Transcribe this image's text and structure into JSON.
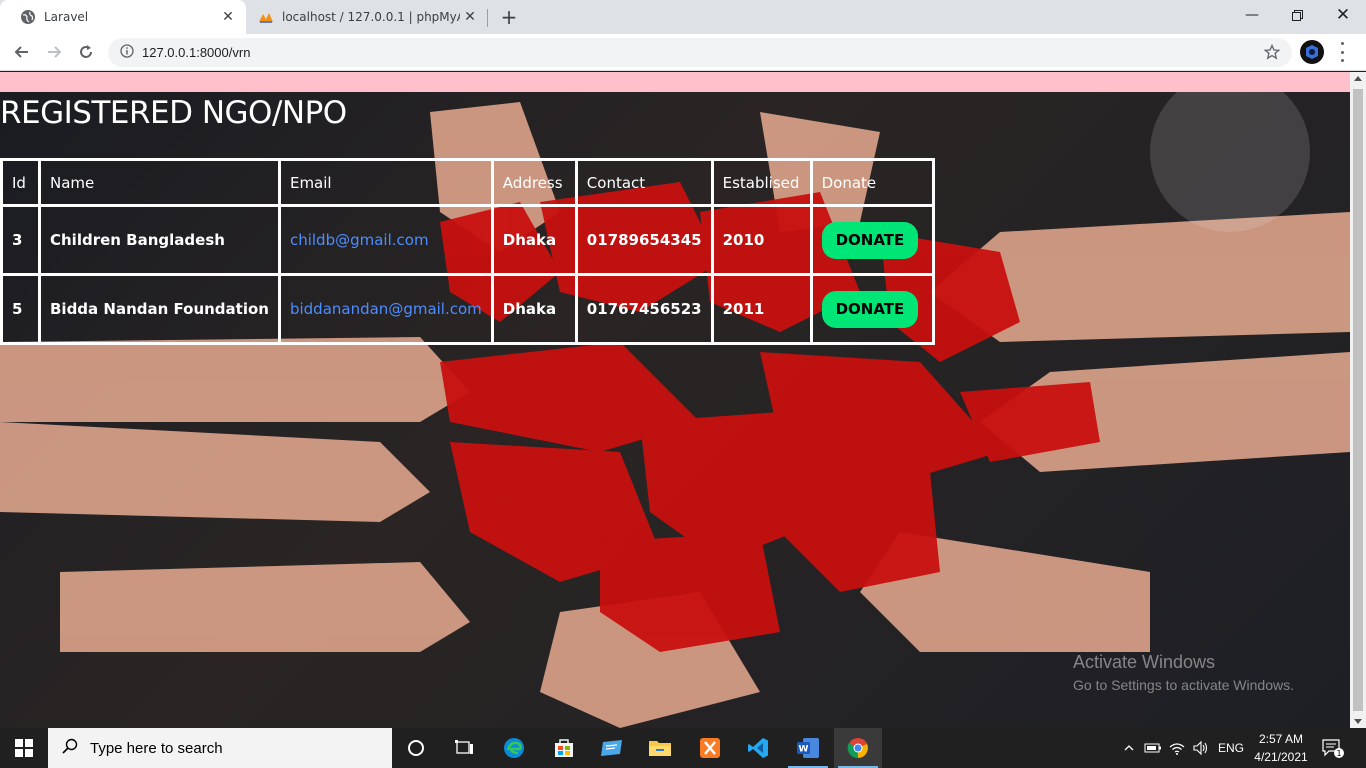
{
  "browser": {
    "tabs": [
      {
        "title": "Laravel",
        "active": true,
        "icon": "globe-icon"
      },
      {
        "title": "localhost / 127.0.0.1 | phpMyAdm",
        "active": false,
        "icon": "phpmyadmin-icon"
      }
    ],
    "url": "127.0.0.1:8000/vrn"
  },
  "page": {
    "title": "REGISTERED NGO/NPO",
    "table": {
      "headers": [
        "Id",
        "Name",
        "Email",
        "Address",
        "Contact",
        "Establised",
        "Donate"
      ],
      "rows": [
        {
          "id": "3",
          "name": "Children Bangladesh",
          "email": "childb@gmail.com",
          "address": "Dhaka",
          "contact": "01789654345",
          "established": "2010",
          "donate_label": "DONATE"
        },
        {
          "id": "5",
          "name": "Bidda Nandan Foundation",
          "email": "biddanandan@gmail.com",
          "address": "Dhaka",
          "contact": "01767456523",
          "established": "2011",
          "donate_label": "DONATE"
        }
      ]
    },
    "colors": {
      "top_bar": "#ffc0cb",
      "donate_button": "#00e676",
      "email_link": "#4d8dff"
    }
  },
  "watermark": {
    "line1": "Activate Windows",
    "line2": "Go to Settings to activate Windows."
  },
  "taskbar": {
    "search_placeholder": "Type here to search",
    "language": "ENG",
    "time": "2:57 AM",
    "date": "4/21/2021",
    "notification_count": "1",
    "pinned_apps": [
      "cortana-icon",
      "task-view-icon",
      "edge-icon",
      "store-icon",
      "remote-desktop-icon",
      "file-explorer-icon",
      "xampp-icon",
      "vscode-icon",
      "word-icon",
      "chrome-icon"
    ]
  }
}
